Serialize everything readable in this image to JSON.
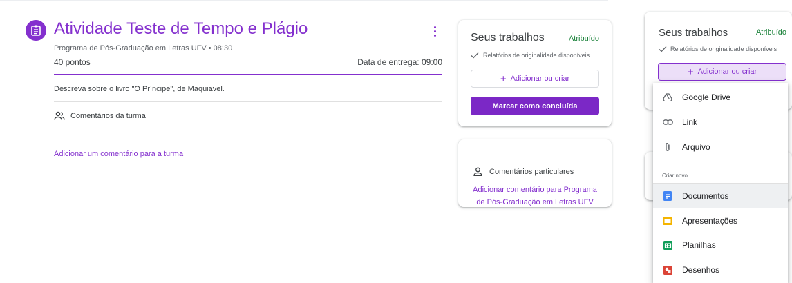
{
  "assignment": {
    "title": "Atividade Teste de Tempo e Plágio",
    "meta": "Programa de Pós-Graduação em Letras UFV • 08:30",
    "points": "40 pontos",
    "due": "Data de entrega: 09:00",
    "description": "Descreva sobre o livro \"O Príncipe\", de Maquiavel.",
    "class_comments_label": "Comentários da turma",
    "add_class_comment": "Adicionar um comentário para a turma",
    "accent_color": "#8430ce"
  },
  "your_work": {
    "title": "Seus trabalhos",
    "status": "Atribuído",
    "originality": "Relatórios de originalidade disponíveis",
    "add_label": "Adicionar ou criar",
    "mark_done": "Marcar como concluída",
    "status_color": "#188038"
  },
  "private_comments": {
    "label": "Comentários particulares",
    "add_link": "Adicionar comentário para Programa de Pós-Graduação em Letras UFV"
  },
  "your_work_bg": {
    "title": "Seus trabalhos",
    "status": "Atribuído",
    "originality": "Relatórios de originalidade disponíveis",
    "add_label": "Adicionar ou criar"
  },
  "menu": {
    "items": [
      {
        "label": "Google Drive",
        "icon": "google-drive-icon"
      },
      {
        "label": "Link",
        "icon": "link-icon"
      },
      {
        "label": "Arquivo",
        "icon": "paperclip-icon"
      }
    ],
    "section_label": "Criar novo",
    "create": [
      {
        "label": "Documentos",
        "icon": "docs-icon",
        "color": "#4285f4"
      },
      {
        "label": "Apresentações",
        "icon": "slides-icon",
        "color": "#f4b400"
      },
      {
        "label": "Planilhas",
        "icon": "sheets-icon",
        "color": "#0f9d58"
      },
      {
        "label": "Desenhos",
        "icon": "drawings-icon",
        "color": "#db4437"
      }
    ]
  }
}
